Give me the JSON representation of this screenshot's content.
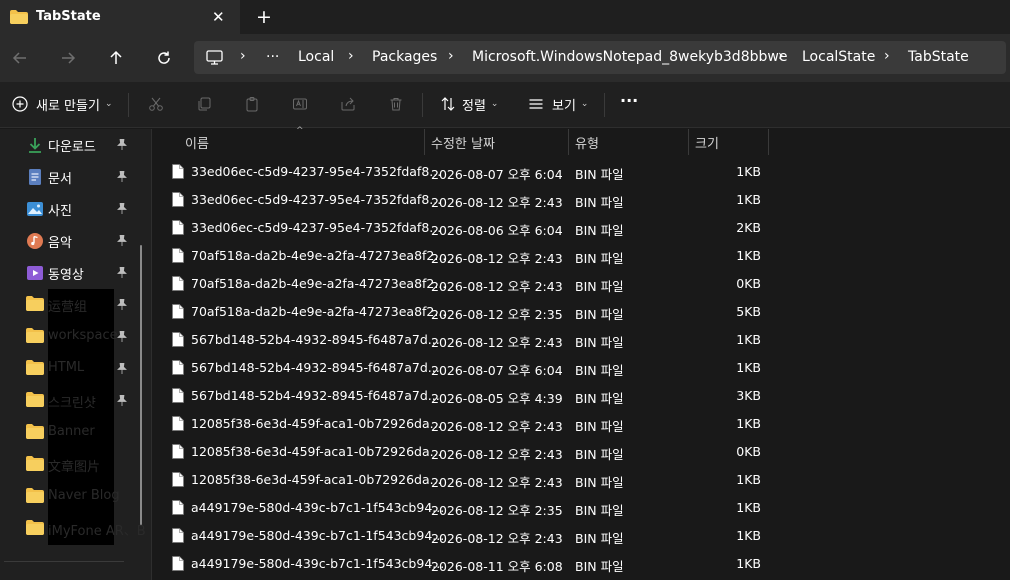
{
  "tab": {
    "title": "TabState",
    "close": "✕",
    "new": "+"
  },
  "address": {
    "more": "···",
    "segments": [
      "Local",
      "Packages",
      "Microsoft.WindowsNotepad_8wekyb3d8bbwe",
      "LocalState",
      "TabState"
    ]
  },
  "commands": {
    "new": "새로 만들기",
    "sort": "정렬",
    "view": "보기",
    "more": "···"
  },
  "nav": [
    {
      "label": "다운로드",
      "icon": "download-icon",
      "color": "#3aa35a",
      "pinned": true
    },
    {
      "label": "문서",
      "icon": "document-icon",
      "color": "#5b7fbf",
      "pinned": true
    },
    {
      "label": "사진",
      "icon": "pictures-icon",
      "color": "#3c8fd6",
      "pinned": true
    },
    {
      "label": "음악",
      "icon": "music-icon",
      "color": "#e07a52",
      "pinned": true
    },
    {
      "label": "동영상",
      "icon": "video-icon",
      "color": "#8e5cd6",
      "pinned": true
    },
    {
      "label": "运营组",
      "icon": "folder-icon",
      "color": "#f3c14a",
      "pinned": true
    },
    {
      "label": "workspace",
      "icon": "folder-icon",
      "color": "#f3c14a",
      "pinned": true
    },
    {
      "label": "HTML",
      "icon": "folder-icon",
      "color": "#f3c14a",
      "pinned": true
    },
    {
      "label": "스크린샷",
      "icon": "folder-icon",
      "color": "#f3c14a",
      "pinned": true
    },
    {
      "label": "Banner",
      "icon": "folder-icon",
      "color": "#f3c14a",
      "pinned": false
    },
    {
      "label": "文章图片",
      "icon": "folder-icon",
      "color": "#f3c14a",
      "pinned": false
    },
    {
      "label": "Naver Blog",
      "icon": "folder-icon",
      "color": "#f3c14a",
      "pinned": false
    },
    {
      "label": "iMyFone AR、B",
      "icon": "folder-icon",
      "color": "#f3c14a",
      "pinned": false
    }
  ],
  "columns": {
    "name": "이름",
    "date": "수정한 날짜",
    "type": "유형",
    "size": "크기"
  },
  "files": [
    {
      "name": "33ed06ec-c5d9-4237-95e4-7352fdaf8...",
      "date": "2026-08-07 오후 6:04",
      "type": "BIN 파일",
      "size": "1KB"
    },
    {
      "name": "33ed06ec-c5d9-4237-95e4-7352fdaf8...",
      "date": "2026-08-12 오후 2:43",
      "type": "BIN 파일",
      "size": "1KB"
    },
    {
      "name": "33ed06ec-c5d9-4237-95e4-7352fdaf8...",
      "date": "2026-08-06 오후 6:04",
      "type": "BIN 파일",
      "size": "2KB"
    },
    {
      "name": "70af518a-da2b-4e9e-a2fa-47273ea8f2...",
      "date": "2026-08-12 오후 2:43",
      "type": "BIN 파일",
      "size": "1KB"
    },
    {
      "name": "70af518a-da2b-4e9e-a2fa-47273ea8f2...",
      "date": "2026-08-12 오후 2:43",
      "type": "BIN 파일",
      "size": "0KB"
    },
    {
      "name": "70af518a-da2b-4e9e-a2fa-47273ea8f2...",
      "date": "2026-08-12 오후 2:35",
      "type": "BIN 파일",
      "size": "5KB"
    },
    {
      "name": "567bd148-52b4-4932-8945-f6487a7d...",
      "date": "2026-08-12 오후 2:43",
      "type": "BIN 파일",
      "size": "1KB"
    },
    {
      "name": "567bd148-52b4-4932-8945-f6487a7d...",
      "date": "2026-08-07 오후 6:04",
      "type": "BIN 파일",
      "size": "1KB"
    },
    {
      "name": "567bd148-52b4-4932-8945-f6487a7d...",
      "date": "2026-08-05 오후 4:39",
      "type": "BIN 파일",
      "size": "3KB"
    },
    {
      "name": "12085f38-6e3d-459f-aca1-0b72926da...",
      "date": "2026-08-12 오후 2:43",
      "type": "BIN 파일",
      "size": "1KB"
    },
    {
      "name": "12085f38-6e3d-459f-aca1-0b72926da...",
      "date": "2026-08-12 오후 2:43",
      "type": "BIN 파일",
      "size": "0KB"
    },
    {
      "name": "12085f38-6e3d-459f-aca1-0b72926da...",
      "date": "2026-08-12 오후 2:43",
      "type": "BIN 파일",
      "size": "1KB"
    },
    {
      "name": "a449179e-580d-439c-b7c1-1f543cb94...",
      "date": "2026-08-12 오후 2:35",
      "type": "BIN 파일",
      "size": "1KB"
    },
    {
      "name": "a449179e-580d-439c-b7c1-1f543cb94...",
      "date": "2026-08-12 오후 2:43",
      "type": "BIN 파일",
      "size": "1KB"
    },
    {
      "name": "a449179e-580d-439c-b7c1-1f543cb94...",
      "date": "2026-08-11 오후 6:08",
      "type": "BIN 파일",
      "size": "1KB"
    }
  ]
}
